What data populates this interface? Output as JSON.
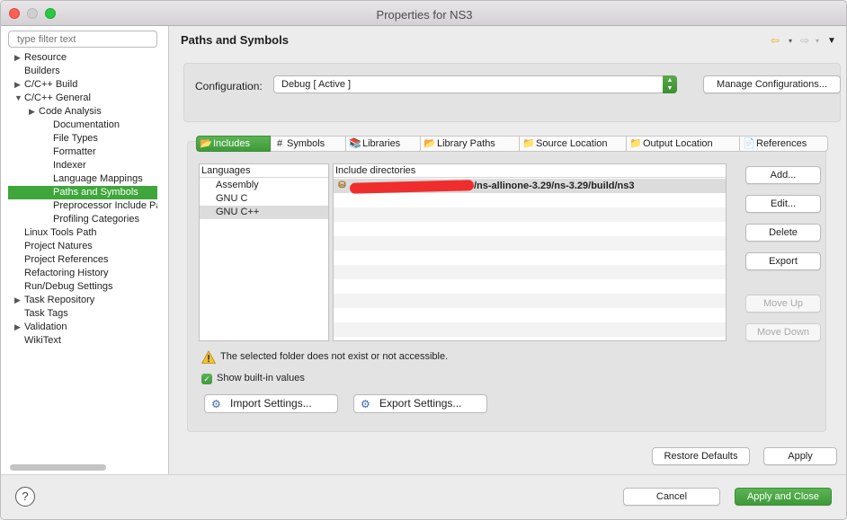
{
  "window": {
    "title": "Properties for NS3"
  },
  "sidebar": {
    "filter_placeholder": "type filter text",
    "items": [
      {
        "label": "Resource",
        "arrow": "▶"
      },
      {
        "label": "Builders",
        "arrow": ""
      },
      {
        "label": "C/C++ Build",
        "arrow": "▶"
      },
      {
        "label": "C/C++ General",
        "arrow": "▼"
      },
      {
        "label": "Code Analysis",
        "arrow": "▶"
      },
      {
        "label": "Documentation",
        "arrow": ""
      },
      {
        "label": "File Types",
        "arrow": ""
      },
      {
        "label": "Formatter",
        "arrow": ""
      },
      {
        "label": "Indexer",
        "arrow": ""
      },
      {
        "label": "Language Mappings",
        "arrow": ""
      },
      {
        "label": "Paths and Symbols",
        "arrow": ""
      },
      {
        "label": "Preprocessor Include Pat",
        "arrow": ""
      },
      {
        "label": "Profiling Categories",
        "arrow": ""
      },
      {
        "label": "Linux Tools Path",
        "arrow": ""
      },
      {
        "label": "Project Natures",
        "arrow": ""
      },
      {
        "label": "Project References",
        "arrow": ""
      },
      {
        "label": "Refactoring History",
        "arrow": ""
      },
      {
        "label": "Run/Debug Settings",
        "arrow": ""
      },
      {
        "label": "Task Repository",
        "arrow": "▶"
      },
      {
        "label": "Task Tags",
        "arrow": ""
      },
      {
        "label": "Validation",
        "arrow": "▶"
      },
      {
        "label": "WikiText",
        "arrow": ""
      }
    ],
    "selected_item": "Paths and Symbols"
  },
  "header": {
    "title": "Paths and Symbols",
    "back_icon": "⇦",
    "forward_icon": "⇨",
    "dropdown_glyph": "▾",
    "menu_glyph": "▼"
  },
  "configuration": {
    "label": "Configuration:",
    "value": "Debug  [ Active ]",
    "stepper_up": "▲",
    "stepper_down": "▼",
    "manage_button": "Manage Configurations..."
  },
  "tabs": [
    {
      "label": "Includes",
      "icon": "📂",
      "active": true
    },
    {
      "label": "Symbols",
      "icon": "#",
      "active": false
    },
    {
      "label": "Libraries",
      "icon": "📚",
      "active": false
    },
    {
      "label": "Library Paths",
      "icon": "📂",
      "active": false
    },
    {
      "label": "Source Location",
      "icon": "📁",
      "active": false
    },
    {
      "label": "Output Location",
      "icon": "📁",
      "active": false
    },
    {
      "label": "References",
      "icon": "📄",
      "active": false
    }
  ],
  "languages": {
    "header": "Languages",
    "items": [
      "Assembly",
      "GNU C",
      "GNU C++"
    ],
    "selected": "GNU C++"
  },
  "includes": {
    "header": "Include directories",
    "rows": [
      {
        "path": "/ns-allinone-3.29/ns-3.29/build/ns3",
        "icon": "⛁"
      }
    ]
  },
  "side_buttons": {
    "add": "Add...",
    "edit": "Edit...",
    "delete": "Delete",
    "export": "Export",
    "move_up": "Move Up",
    "move_down": "Move Down"
  },
  "warning": {
    "icon": "⚠",
    "text": "The selected folder does not exist or not accessible."
  },
  "show_builtin": {
    "label": "Show built-in values",
    "checked": true,
    "check_glyph": "✓"
  },
  "settings_buttons": {
    "import": "Import Settings...",
    "export": "Export Settings...",
    "import_icon": "⚙",
    "export_icon": "⚙"
  },
  "page_buttons": {
    "restore": "Restore Defaults",
    "apply": "Apply"
  },
  "footer": {
    "help_glyph": "?",
    "cancel": "Cancel",
    "apply_close": "Apply and Close"
  },
  "colors": {
    "accent_green": "#3ea63a",
    "warning_yellow": "#f3c230",
    "redaction_red": "#f02d2d"
  }
}
